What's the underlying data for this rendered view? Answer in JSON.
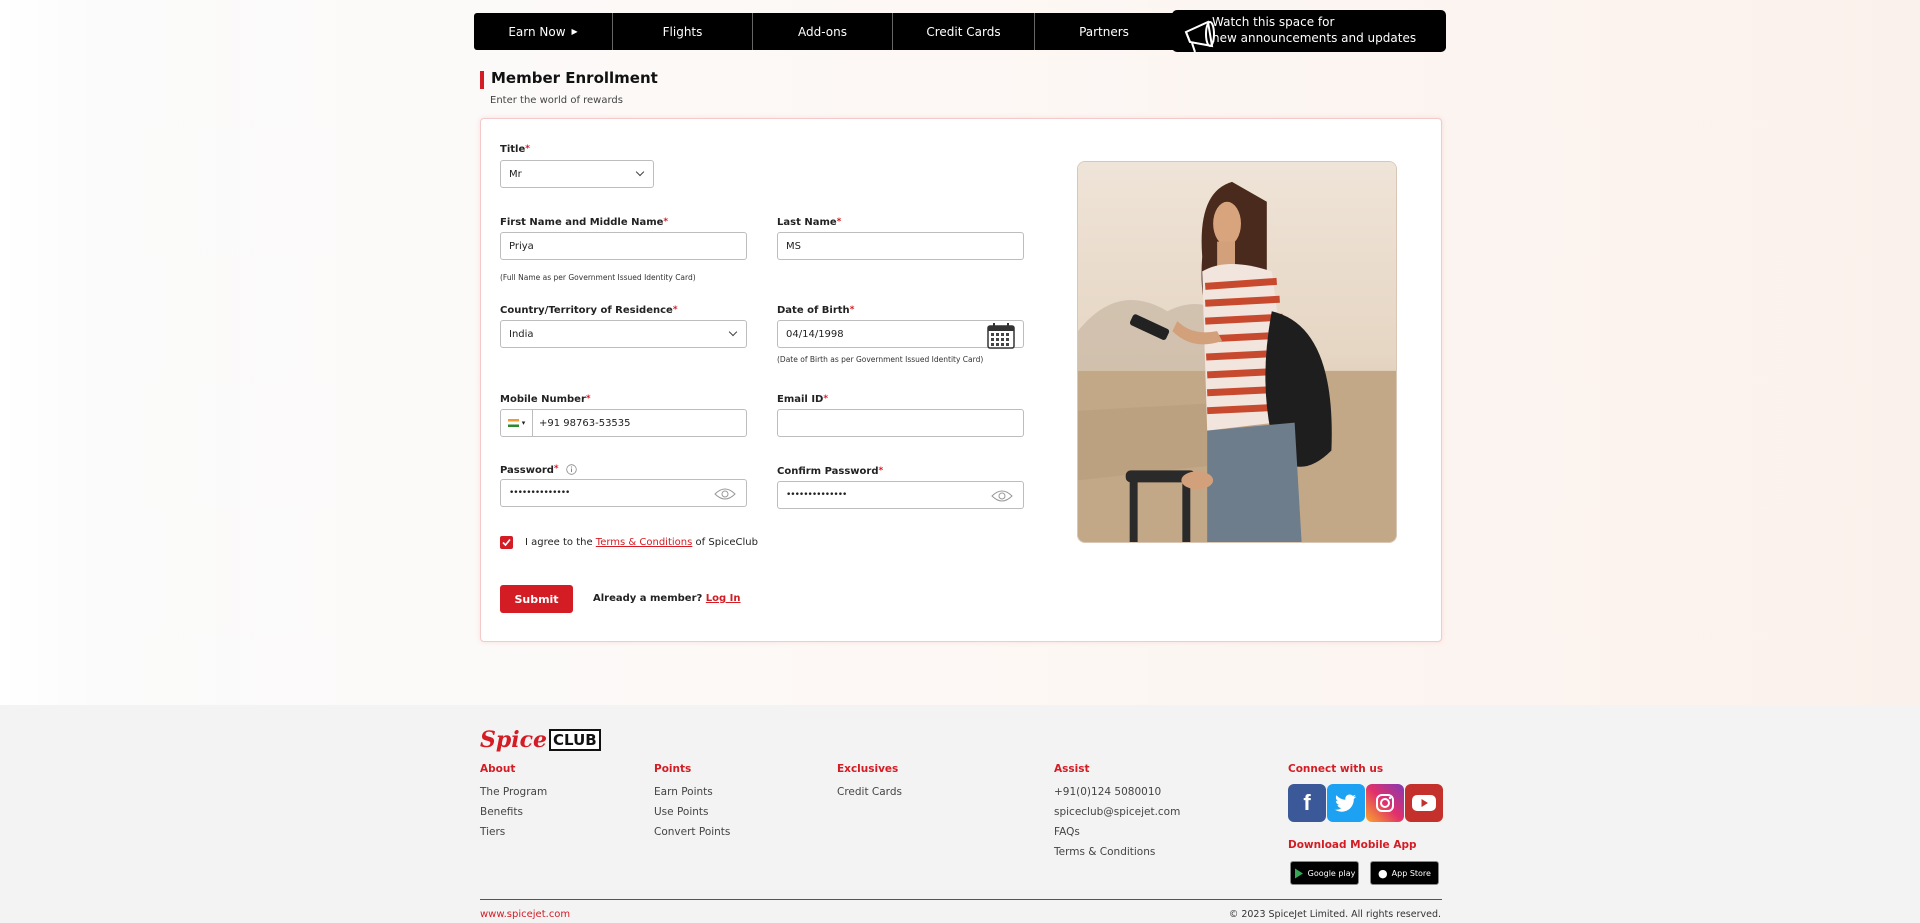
{
  "nav": {
    "items": [
      {
        "label": "Earn Now",
        "has_caret": true
      },
      {
        "label": "Flights"
      },
      {
        "label": "Add-ons"
      },
      {
        "label": "Credit Cards"
      },
      {
        "label": "Partners"
      }
    ],
    "announcement_line1": "Watch this space for",
    "announcement_line2": "new announcements and updates"
  },
  "header": {
    "title": "Member Enrollment",
    "subtitle": "Enter the world of rewards"
  },
  "form": {
    "required_mark": "*",
    "title_label": "Title",
    "title_value": "Mr",
    "first_name_label": "First Name and Middle Name",
    "first_name_value": "Priya",
    "first_name_note": "(Full Name as per Government Issued Identity Card)",
    "last_name_label": "Last Name",
    "last_name_value": "MS",
    "country_label": "Country/Territory of Residence",
    "country_value": "India",
    "dob_label": "Date of Birth",
    "dob_value": "04/14/1998",
    "dob_note": "(Date of Birth as per Government Issued Identity Card)",
    "mobile_label": "Mobile Number",
    "mobile_value": "+91 98763-53535",
    "email_label": "Email ID",
    "email_value": "",
    "password_label": "Password",
    "password_value": "••••••••••••••",
    "confirm_label": "Confirm Password",
    "confirm_value": "••••••••••••••",
    "agree_prefix": "I agree to the",
    "agree_link": "Terms & Conditions",
    "agree_suffix": "of SpiceClub",
    "agree_checked": true,
    "submit_label": "Submit",
    "already_text": "Already a member?",
    "login_label": "Log In"
  },
  "footer": {
    "logo_spice": "Spice",
    "logo_club": "CLUB",
    "about": {
      "heading": "About",
      "links": [
        "The Program",
        "Benefits",
        "Tiers"
      ]
    },
    "points": {
      "heading": "Points",
      "links": [
        "Earn Points",
        "Use Points",
        "Convert Points"
      ]
    },
    "exclusives": {
      "heading": "Exclusives",
      "links": [
        "Credit Cards"
      ]
    },
    "assist": {
      "heading": "Assist",
      "links": [
        "+91(0)124 5080010",
        "spiceclub@spicejet.com",
        "FAQs",
        "Terms & Conditions"
      ]
    },
    "connect_heading": "Connect with us",
    "social": [
      "facebook",
      "twitter",
      "instagram",
      "youtube"
    ],
    "app_heading": "Download Mobile App",
    "google_play": "Google play",
    "app_store": "App Store",
    "site": "www.spicejet.com",
    "copyright": "© 2023 SpiceJet Limited. All rights reserved."
  },
  "colors": {
    "brand_red": "#d31c24",
    "nav_bg": "#000000"
  }
}
